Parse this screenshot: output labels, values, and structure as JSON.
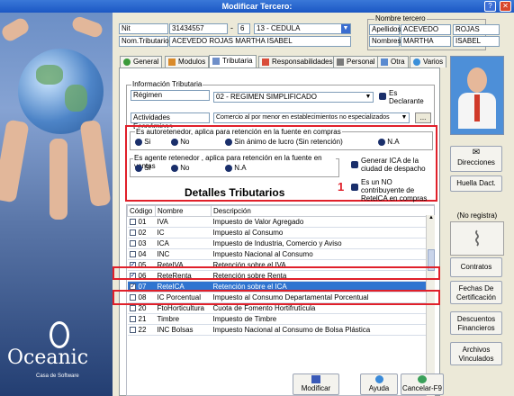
{
  "window": {
    "title": "Modificar Tercero:"
  },
  "brand": {
    "name": "Oceanic",
    "subtitle": "Casa de Software"
  },
  "header": {
    "nit_label": "Nit",
    "nit_value": "31434557",
    "dv_separator": "-",
    "dv_value": "6",
    "doc_type": "13 - CEDULA",
    "nom_label": "Nom.Tributario",
    "nom_value": "ACEVEDO ROJAS MARTHA ISABEL",
    "nombre_group": "Nombre tercero",
    "apellidos_label": "Apellidos",
    "apellido1": "ACEVEDO",
    "apellido2": "ROJAS",
    "nombres_label": "Nombres",
    "nombre1": "MARTHA",
    "nombre2": "ISABEL"
  },
  "tabs": [
    {
      "label": "General"
    },
    {
      "label": "Modulos"
    },
    {
      "label": "Tributaria"
    },
    {
      "label": "Responsabilidades"
    },
    {
      "label": "Personal"
    },
    {
      "label": "Otra"
    },
    {
      "label": "Varios"
    }
  ],
  "info": {
    "group_label": "Información Tributaria",
    "regimen_label": "Régimen",
    "regimen_value": "02 - REGIMEN SIMPLIFICADO",
    "declarante_label": "Es Declarante",
    "actividades_label": "Actividades Económicas",
    "actividades_value": "Comercio al por menor en establecimientos no especializados",
    "ellipsis": "..."
  },
  "autoretenedor": {
    "label": "Es autoretenedor, aplica para retención en la fuente en compras",
    "options": [
      "Si",
      "No",
      "Sin ánimo de lucro (Sin retención)",
      "N.A"
    ]
  },
  "agente": {
    "label": "Es agente retenedor , aplica para retención en la fuente en ventas",
    "options": [
      "Si",
      "No",
      "N.A"
    ]
  },
  "ica": {
    "label": "Generar ICA de la ciudad de despacho"
  },
  "nocontrib": {
    "label": "Es un NO contribuyente de RetelCA en compras",
    "number": "1"
  },
  "detalles_title": "Detalles Tributarios",
  "table": {
    "headers": [
      "Código",
      "Nombre",
      "Descripción"
    ],
    "rows": [
      {
        "code": "01",
        "name": "IVA",
        "desc": "Impuesto de Valor Agregado",
        "checked": false
      },
      {
        "code": "02",
        "name": "IC",
        "desc": "Impuesto al Consumo",
        "checked": false
      },
      {
        "code": "03",
        "name": "ICA",
        "desc": "Impuesto de Industria, Comercio y Aviso",
        "checked": false
      },
      {
        "code": "04",
        "name": "INC",
        "desc": "Impuesto Nacional al Consumo",
        "checked": false
      },
      {
        "code": "05",
        "name": "ReteIVA",
        "desc": "Retención sobre el IVA",
        "checked": true
      },
      {
        "code": "06",
        "name": "ReteRenta",
        "desc": "Retención sobre Renta",
        "checked": true
      },
      {
        "code": "07",
        "name": "ReteICA",
        "desc": "Retención sobre el ICA",
        "checked": true
      },
      {
        "code": "08",
        "name": "IC Porcentual",
        "desc": "Impuesto al Consumo Departamental Porcentual",
        "checked": false
      },
      {
        "code": "20",
        "name": "FtoHorticultura",
        "desc": "Cuota de Fomento Hortifrutícula",
        "checked": false
      },
      {
        "code": "21",
        "name": "Timbre",
        "desc": "Impuesto de Timbre",
        "checked": false
      },
      {
        "code": "22",
        "name": "INC Bolsas",
        "desc": "Impuesto Nacional al Consumo de Bolsa Plástica",
        "checked": false
      }
    ]
  },
  "right": {
    "direcciones": "Direcciones",
    "huella": "Huella Dact.",
    "no_registra": "(No registra)",
    "contratos": "Contratos",
    "fechas": "Fechas De Certificación",
    "descuentos": "Descuentos Financieros",
    "archivos": "Archivos Vinculados"
  },
  "footer": {
    "modificar": "Modificar",
    "ayuda": "Ayuda",
    "cancelar": "Cancelar-F9"
  }
}
